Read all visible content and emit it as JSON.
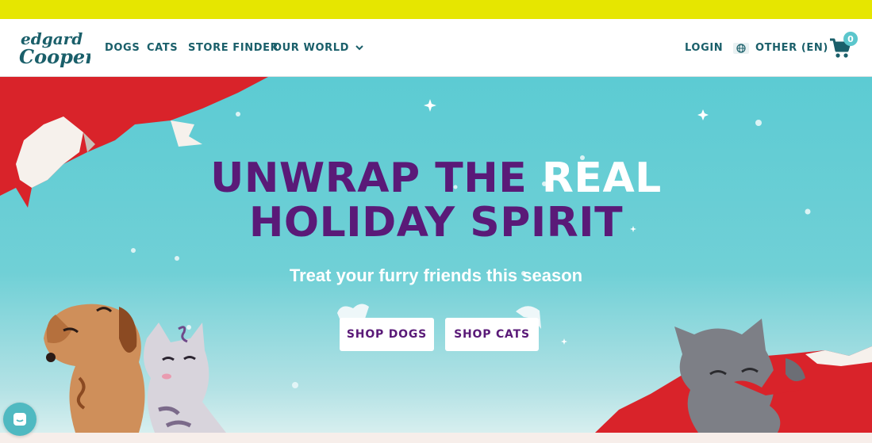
{
  "header": {
    "logo_text": "edgard Cooper",
    "nav": {
      "dogs": "DOGS",
      "cats": "CATS",
      "store_finder": "STORE FINDER",
      "our_world": "OUR WORLD"
    },
    "login": "LOGIN",
    "language": "OTHER (EN)",
    "cart_count": "0",
    "icons": [
      "chevron-down-icon",
      "globe-icon",
      "cart-icon"
    ]
  },
  "hero": {
    "headline_part1": "UNWRAP THE ",
    "headline_highlight": "REAL",
    "headline_line2": "HOLIDAY SPIRIT",
    "subtitle": "Treat your furry friends this season",
    "buttons": {
      "shop_dogs": "SHOP DOGS",
      "shop_cats": "SHOP CATS"
    }
  },
  "colors": {
    "top_bar": "#e6e600",
    "brand_teal": "#1a5f6a",
    "hero_bg": "#5ccbd3",
    "headline_purple": "#5a1a78",
    "wrap_red": "#d9232a",
    "badge": "#5bc6cc"
  },
  "chat": {
    "icon": "chat-icon"
  }
}
